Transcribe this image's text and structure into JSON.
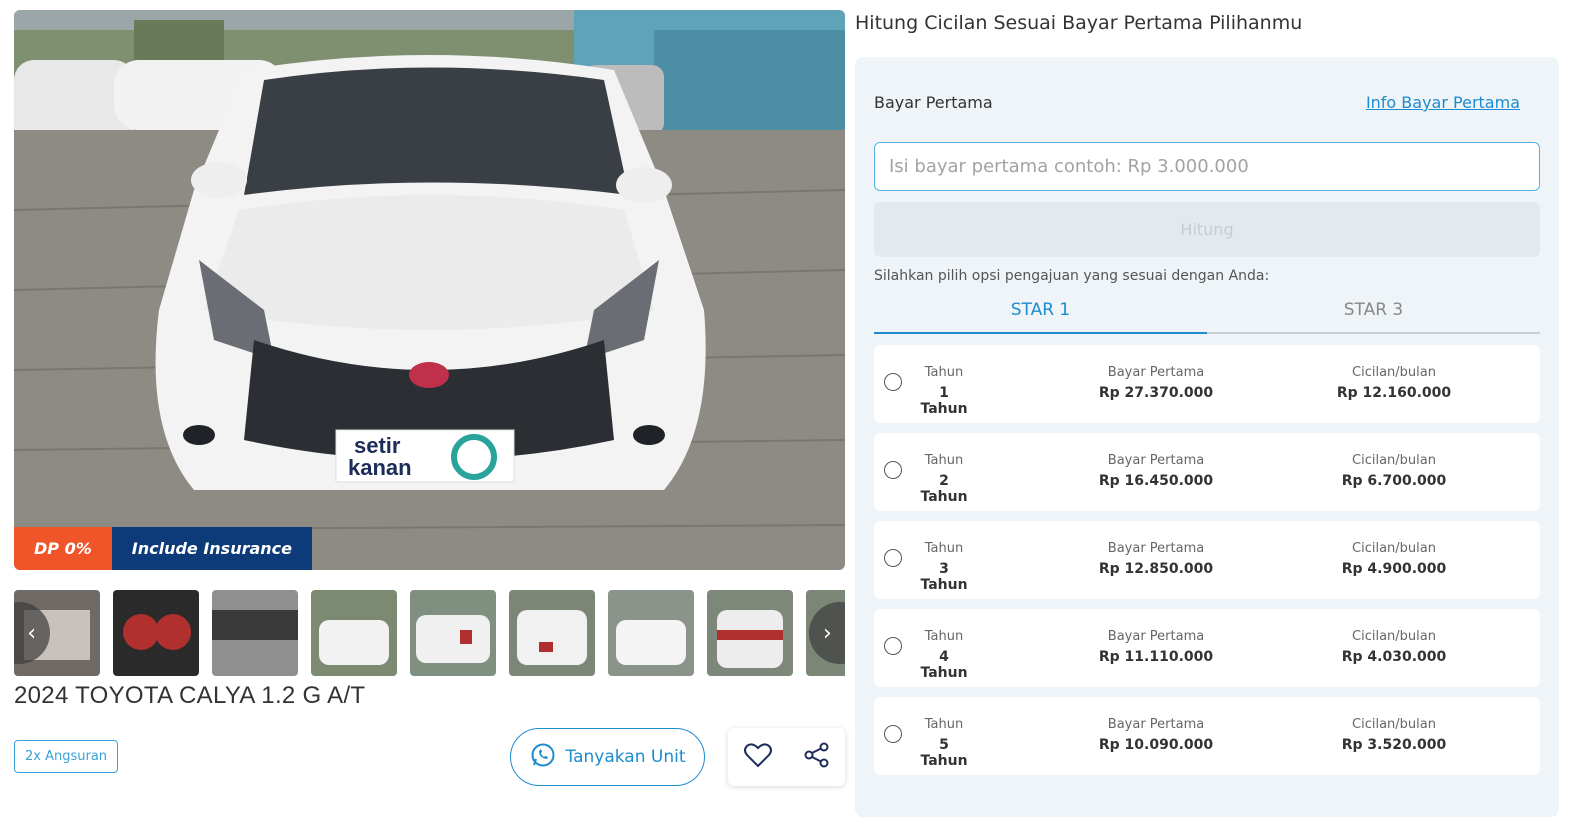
{
  "badges": {
    "dp": "DP 0%",
    "insurance": "Include Insurance"
  },
  "car": {
    "title": "2024 TOYOTA CALYA 1.2 G A/T",
    "plate_text_line1": "setir",
    "plate_text_line2": "kanan"
  },
  "tags": {
    "angsuran": "2x Angsuran"
  },
  "actions": {
    "tanyakan": "Tanyakan Unit"
  },
  "icons": {
    "whatsapp": "whatsapp-icon",
    "heart": "heart-icon",
    "share": "share-icon",
    "prev": "chevron-left-icon",
    "next": "chevron-right-icon"
  },
  "calc": {
    "title": "Hitung Cicilan Sesuai Bayar Pertama Pilihanmu",
    "bayar_label": "Bayar Pertama",
    "info_link": "Info Bayar Pertama",
    "input_placeholder": "Isi bayar pertama contoh: Rp 3.000.000",
    "hitung_label": "Hitung",
    "hint": "Silahkan pilih opsi pengajuan yang sesuai dengan Anda:",
    "tabs": [
      {
        "label": "STAR 1",
        "active": true
      },
      {
        "label": "STAR 3",
        "active": false
      }
    ],
    "col_labels": {
      "tahun": "Tahun",
      "bayar": "Bayar Pertama",
      "cicilan": "Cicilan/bulan"
    },
    "plans": [
      {
        "tahun": "1 Tahun",
        "bayar": "Rp 27.370.000",
        "cicilan": "Rp 12.160.000"
      },
      {
        "tahun": "2 Tahun",
        "bayar": "Rp 16.450.000",
        "cicilan": "Rp 6.700.000"
      },
      {
        "tahun": "3 Tahun",
        "bayar": "Rp 12.850.000",
        "cicilan": "Rp 4.900.000"
      },
      {
        "tahun": "4 Tahun",
        "bayar": "Rp 11.110.000",
        "cicilan": "Rp 4.030.000"
      },
      {
        "tahun": "5 Tahun",
        "bayar": "Rp 10.090.000",
        "cicilan": "Rp 3.520.000"
      }
    ]
  },
  "colors": {
    "accent": "#1c8ccf",
    "dp_badge": "#f0552a",
    "insurance_badge": "#0d3b7a",
    "panel_bg": "#eef4f8"
  }
}
